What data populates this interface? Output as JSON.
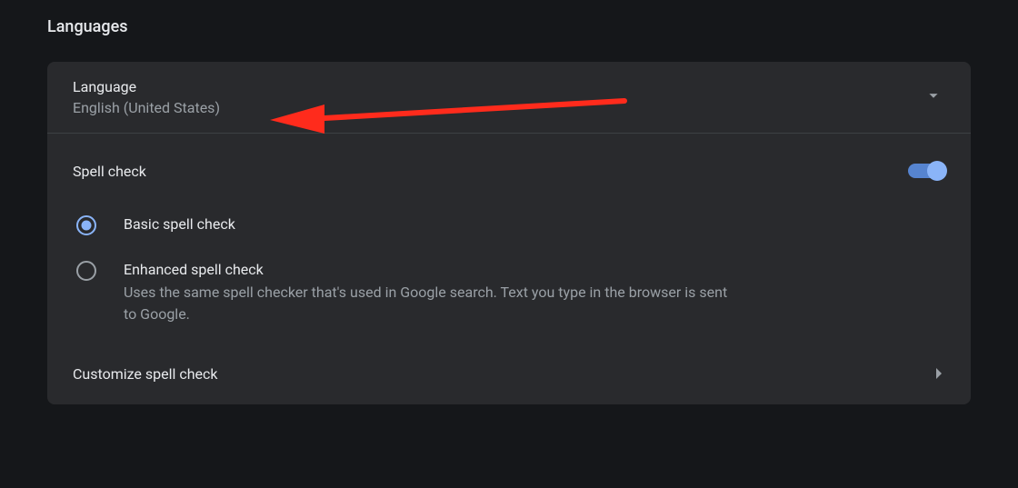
{
  "pageTitle": "Languages",
  "language": {
    "label": "Language",
    "value": "English (United States)"
  },
  "spellCheck": {
    "label": "Spell check",
    "enabled": true,
    "options": [
      {
        "title": "Basic spell check",
        "desc": "",
        "selected": true
      },
      {
        "title": "Enhanced spell check",
        "desc": "Uses the same spell checker that's used in Google search. Text you type in the browser is sent to Google.",
        "selected": false
      }
    ],
    "customizeLabel": "Customize spell check"
  }
}
